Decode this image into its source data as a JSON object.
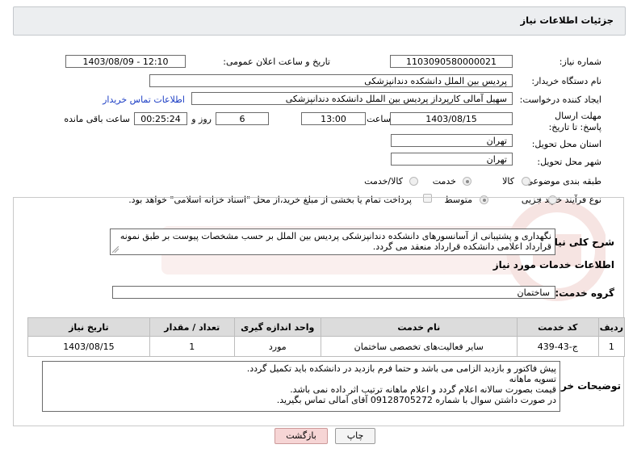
{
  "header": {
    "title": "جزئیات اطلاعات نیاز"
  },
  "fields": {
    "need_number_label": "شماره نیاز:",
    "need_number": "1103090580000021",
    "announce_label": "تاریخ و ساعت اعلان عمومی:",
    "announce_value": "1403/08/09 - 12:10",
    "buyer_org_label": "نام دستگاه خریدار:",
    "buyer_org": "پردیس بین الملل دانشکده دندانپزشکی",
    "creator_label": "ایجاد کننده درخواست:",
    "creator": "سهیل آمالی کارپرداز پردیس بین الملل دانشکده دندانپزشکی",
    "contact_link": "اطلاعات تماس خریدار",
    "deadline_label": "مهلت ارسال پاسخ: تا تاریخ:",
    "deadline_date": "1403/08/15",
    "time_label": "ساعت",
    "deadline_time": "13:00",
    "days_value": "6",
    "days_label": "روز و",
    "remaining_value": "00:25:24",
    "remaining_label": "ساعت باقی مانده",
    "province_label": "استان محل تحویل:",
    "province": "تهران",
    "city_label": "شهر محل تحویل:",
    "city": "تهران",
    "category_label": "طبقه بندی موضوعی:",
    "category_options": [
      "کالا",
      "خدمت",
      "کالا/خدمت"
    ],
    "process_label": "نوع فرآیند خرید :",
    "process_options": [
      "جزیی",
      "متوسط"
    ],
    "payment_note": "پرداخت تمام یا بخشی از مبلغ خرید،از محل \"اسناد خزانه اسلامی\" خواهد بود."
  },
  "summary": {
    "label": "شرح کلی نیاز:",
    "text": "نگهداری و پشتیبانی از آسانسورهای دانشکده دندانپزشکی پردیس بین الملل بر حسب مشخصات پیوست بر طبق نمونه قرارداد اعلامی دانشکده قرارداد منعقد می گردد."
  },
  "services": {
    "section_title": "اطلاعات خدمات مورد نیاز",
    "group_label": "گروه خدمت:",
    "group_value": "ساختمان",
    "columns": [
      "ردیف",
      "کد خدمت",
      "نام خدمت",
      "واحد اندازه گیری",
      "تعداد / مقدار",
      "تاریخ نیاز"
    ],
    "rows": [
      [
        "1",
        "ج-43-439",
        "سایر فعالیت‌های تخصصی ساختمان",
        "مورد",
        "1",
        "1403/08/15"
      ]
    ]
  },
  "buyer_notes": {
    "label": "توضیحات خریدار:",
    "lines": [
      "پیش فاکتور و بازدید الزامی می باشد و حتما فرم بازدید در دانشکده باید تکمیل گردد.",
      "تسویه ماهانه",
      "قیمت بصورت سالانه اعلام گردد و  اعلام ماهانه ترتیب اثر داده نمی باشد.",
      "در صورت داشتن سوال با شماره 09128705272 آقای آمالی تماس بگیرید."
    ]
  },
  "buttons": {
    "print": "چاپ",
    "back": "بازگشت"
  },
  "colors": {
    "link": "#1a3cc4",
    "back_button_bg": "#f6d5d5",
    "watermark": "#c0392b"
  }
}
